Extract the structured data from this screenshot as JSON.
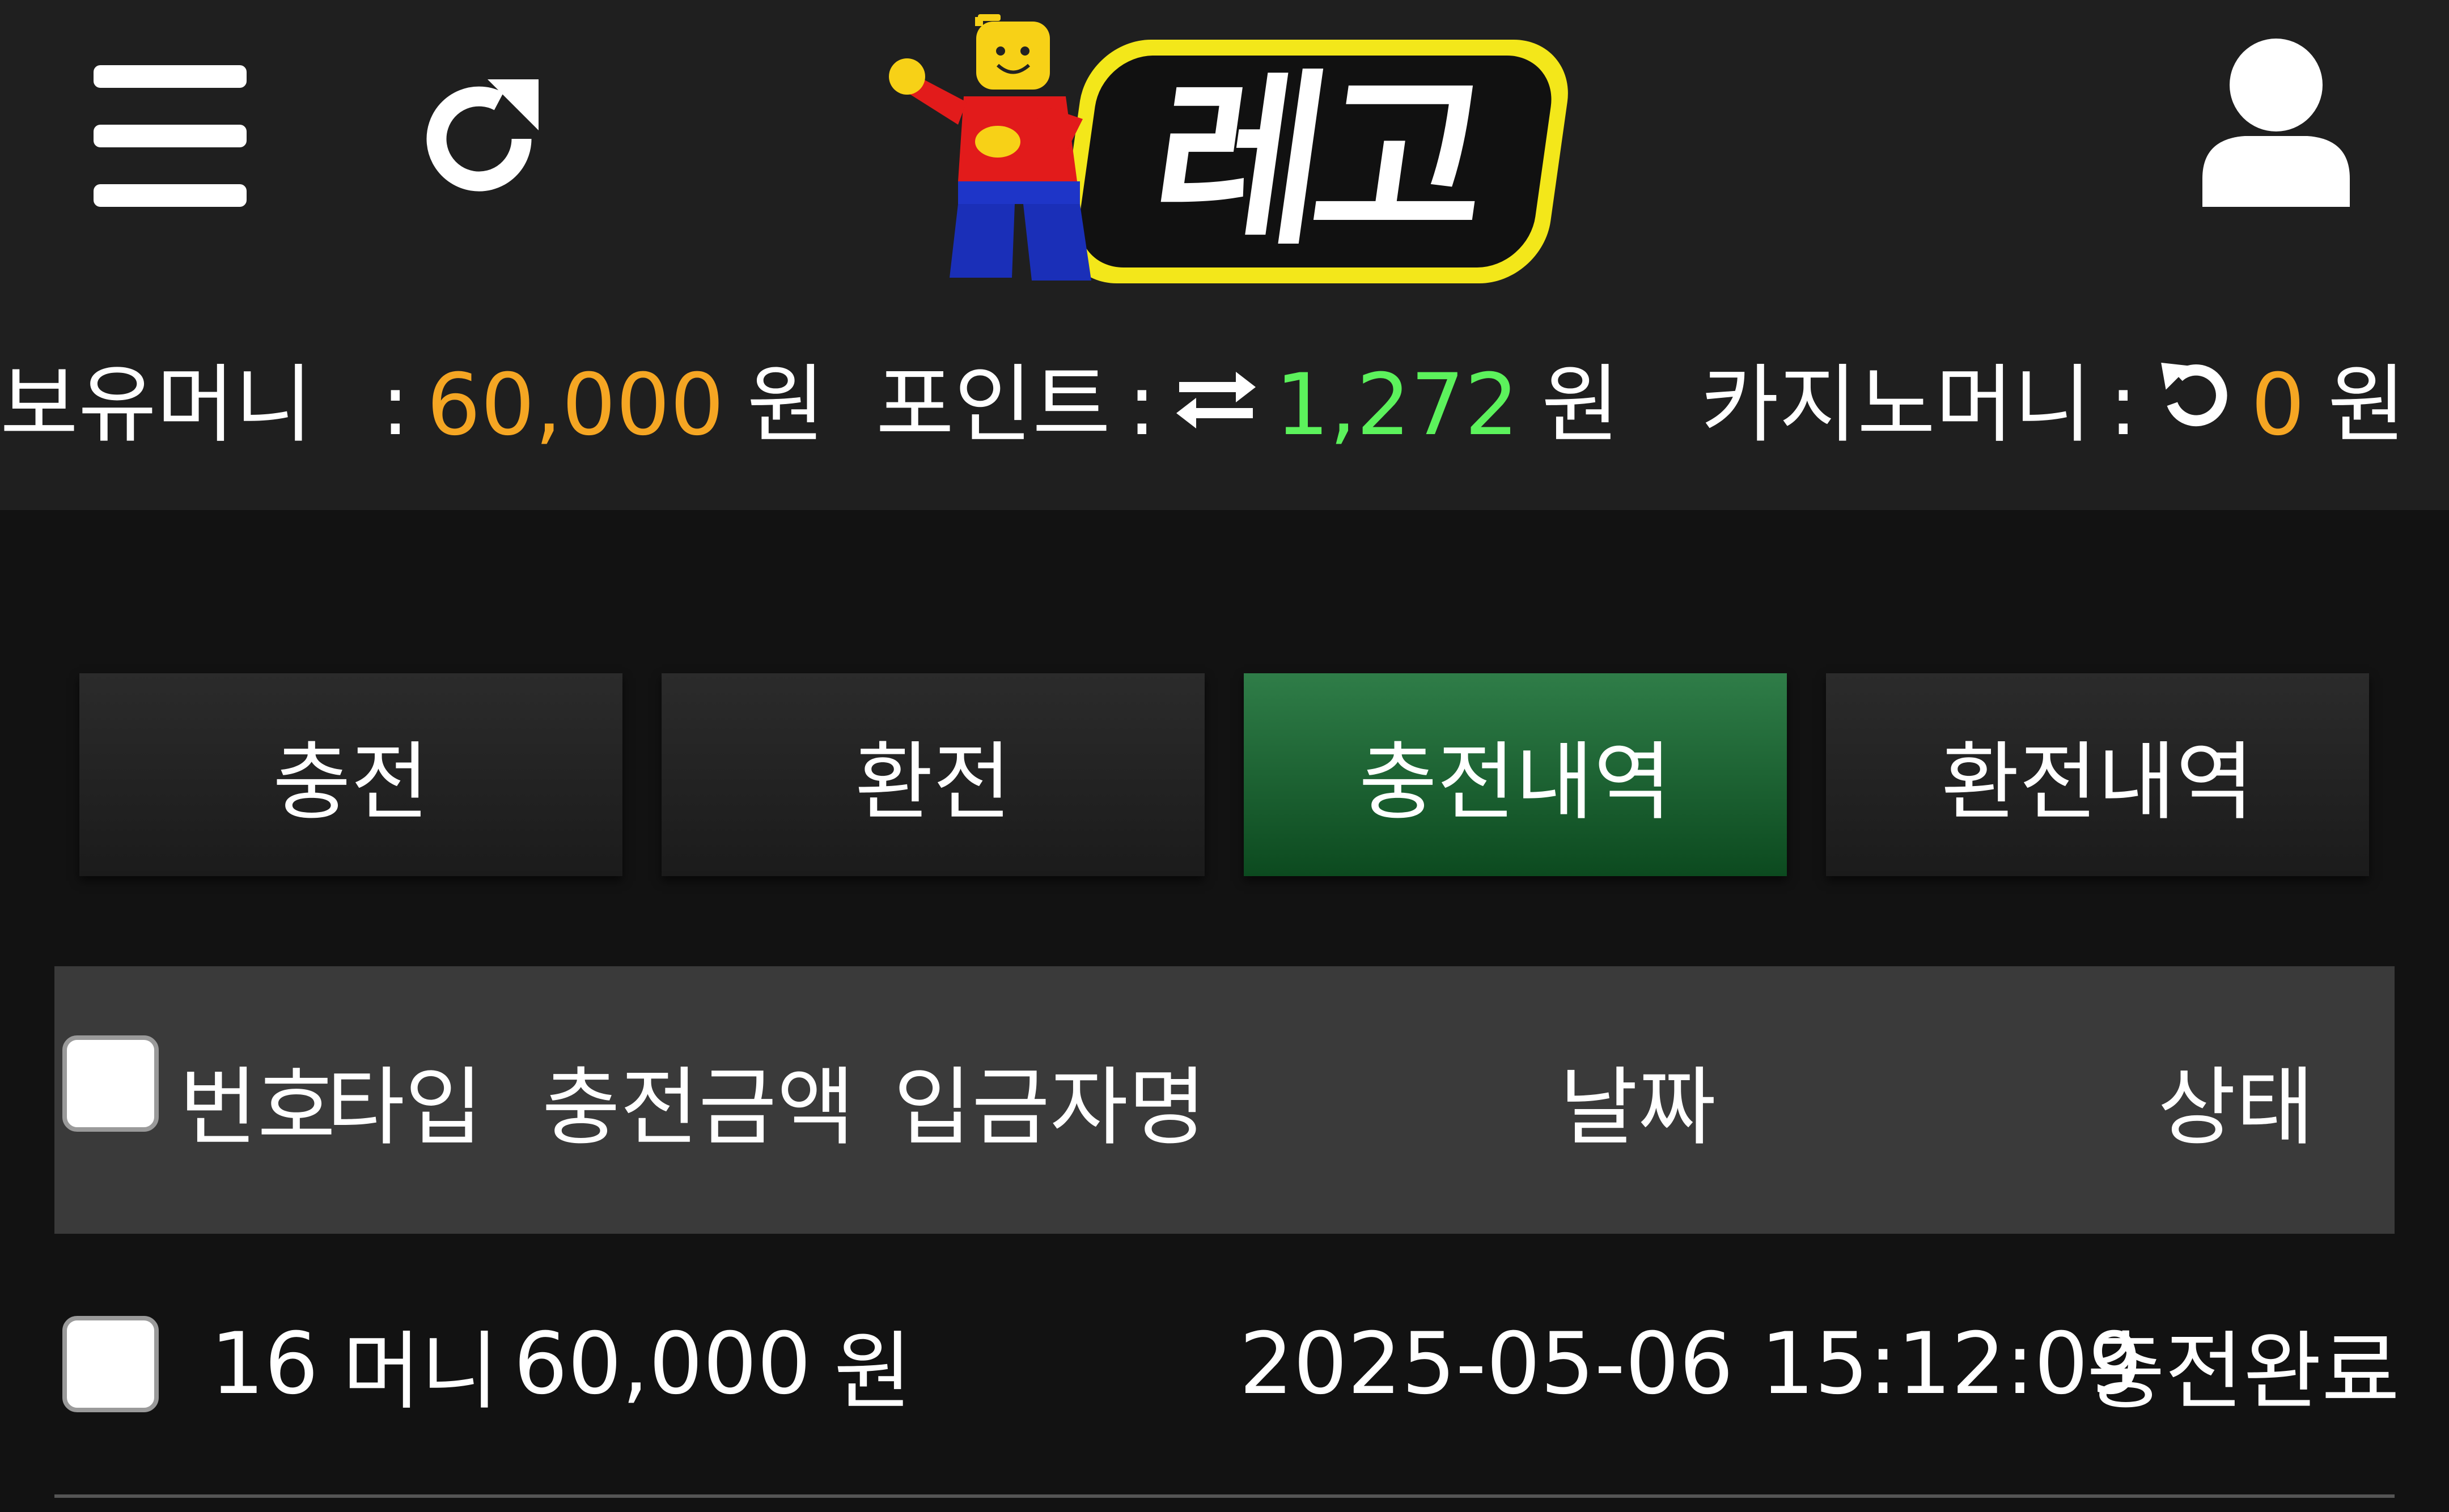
{
  "header": {
    "logo_text": "레고",
    "icons": {
      "menu": "hamburger-menu-icon",
      "refresh": "refresh-icon",
      "user": "user-icon",
      "logo": "lego-minifigure-logo"
    }
  },
  "balances": {
    "money": {
      "label": "보유머니",
      "sep": ":",
      "value": "60,000",
      "unit": "원",
      "color": "#f5a623"
    },
    "point": {
      "label": "포인트",
      "sep": ":",
      "value": "1,272",
      "unit": "원",
      "color": "#5cf25c",
      "icon": "swap-arrows-icon"
    },
    "casino": {
      "label": "카지노머니",
      "sep": ":",
      "value": "0",
      "unit": "원",
      "color": "#f5a623",
      "icon": "rotate-ccw-icon"
    }
  },
  "tabs": [
    {
      "label": "충전",
      "active": false
    },
    {
      "label": "환전",
      "active": false
    },
    {
      "label": "충전내역",
      "active": true
    },
    {
      "label": "환전내역",
      "active": false
    }
  ],
  "table": {
    "headers": {
      "number": "번호",
      "type": "타입",
      "amount": "충전금액",
      "depositor": "입금자명",
      "date": "날짜",
      "status": "상태"
    },
    "rows": [
      {
        "number": "16",
        "type": "머니",
        "amount": "60,000",
        "unit": "원",
        "depositor": "",
        "date": "2025-05-06 15:12:09",
        "status": "충전완료"
      }
    ]
  },
  "colors": {
    "accent_green": "#1f6b35",
    "money_orange": "#f5a623",
    "point_green": "#5cf25c",
    "header_bg": "#1f1f1f",
    "body_bg": "#121212",
    "table_header_bg": "#3a3a3a"
  }
}
